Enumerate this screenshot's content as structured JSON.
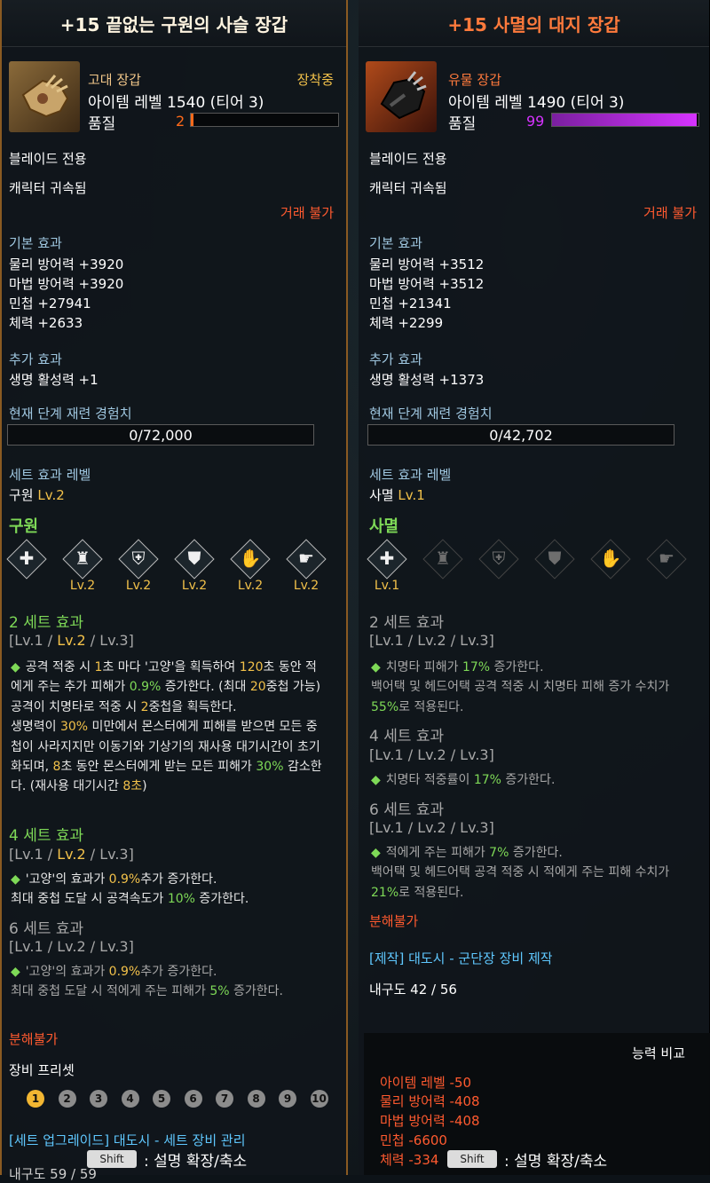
{
  "left": {
    "title": "+15 끝없는 구원의 사슬 장갑",
    "grade": "고대 장갑",
    "equipped": "장착중",
    "item_level": "아이템 레벨 1540 (티어 3)",
    "quality_label": "품질",
    "quality_value": "2",
    "quality_percent": 2,
    "class_only": "블레이드 전용",
    "bound": "캐릭터 귀속됨",
    "trade": "거래 불가",
    "basic_effect_head": "기본 효과",
    "basic_effects": [
      "물리 방어력 +3920",
      "마법 방어력 +3920",
      "민첩 +27941",
      "체력 +2633"
    ],
    "extra_effect_head": "추가 효과",
    "extra_effects": [
      "생명 활성력 +1"
    ],
    "exp_head": "현재 단계 재련 경험치",
    "exp_value": "0/72,000",
    "set_level_head": "세트 효과 레벨",
    "set_level_name": "구원",
    "set_level_lv": "Lv.2",
    "set_name": "구원",
    "set_icons": [
      {
        "name": "sword-icon",
        "glyph": "✚",
        "lv": ""
      },
      {
        "name": "helmet-icon",
        "glyph": "♜",
        "lv": "Lv.2"
      },
      {
        "name": "shoulder-armor-icon",
        "glyph": "⛨",
        "lv": "Lv.2"
      },
      {
        "name": "chest-armor-icon",
        "glyph": "⛊",
        "lv": "Lv.2"
      },
      {
        "name": "glove-icon",
        "glyph": "✋",
        "lv": "Lv.2"
      },
      {
        "name": "boots-icon",
        "glyph": "☛",
        "lv": "Lv.2"
      }
    ],
    "set2_head": "2 세트 효과",
    "set2_lv": {
      "a": "[Lv.1 / ",
      "b": "Lv.2",
      "c": " / Lv.3]"
    },
    "set2_text": {
      "p1": "공격 적중 시 ",
      "n1": "1",
      "p2": "초 마다 '고양'을 획득하여 ",
      "n2": "120",
      "p3": "초 동안 적에게 주는 추가 피해가 ",
      "n3": "0.9%",
      "p4": " 증가한다. (최대 ",
      "n4": "20",
      "p5": "중첩 가능)",
      "p6": "공격이 치명타로 적중 시 ",
      "n5": "2",
      "p7": "중첩을 획득한다.",
      "p8": "생명력이 ",
      "n6": "30%",
      "p9": " 미만에서 몬스터에게 피해를 받으면 모든 중첩이 사라지지만 이동기와 기상기의 재사용 대기시간이 초기화되며, ",
      "n7": "8",
      "p10": "초 동안 몬스터에게 받는 모든 피해가 ",
      "n8": "30%",
      "p11": " 감소한다. (재사용 대기시간 ",
      "n9": "8초",
      "p12": ")"
    },
    "set4_head": "4 세트 효과",
    "set4_lv": {
      "a": "[Lv.1 / ",
      "b": "Lv.2",
      "c": " / Lv.3]"
    },
    "set4_text": {
      "p1": "'고양'의 효과가 ",
      "n1": "0.9%",
      "p2": "추가 증가한다.",
      "p3": "최대 중첩 도달 시 공격속도가 ",
      "n2": "10%",
      "p4": " 증가한다."
    },
    "set6_head": "6 세트 효과",
    "set6_lv": "[Lv.1 / Lv.2 / Lv.3]",
    "set6_text": {
      "p1": "'고양'의 효과가 ",
      "n1": "0.9%",
      "p2": "추가 증가한다.",
      "p3": "최대 중첩 도달 시 적에게 주는 피해가 ",
      "n2": "5%",
      "p4": " 증가한다."
    },
    "disassemble": "분해불가",
    "preset_head": "장비 프리셋",
    "presets": [
      "1",
      "2",
      "3",
      "4",
      "5",
      "6",
      "7",
      "8",
      "9",
      "10"
    ],
    "upgrade_link": "[세트 업그레이드] 대도시 - 세트 장비 관리",
    "durability": "내구도 59 / 59",
    "shift_key": "Shift",
    "shift_text": ": 설명 확장/축소"
  },
  "right": {
    "title": "+15 사멸의 대지 장갑",
    "grade": "유물 장갑",
    "item_level": "아이템 레벨 1490 (티어 3)",
    "quality_label": "품질",
    "quality_value": "99",
    "quality_percent": 99,
    "class_only": "블레이드 전용",
    "bound": "캐릭터 귀속됨",
    "trade": "거래 불가",
    "basic_effect_head": "기본 효과",
    "basic_effects": [
      "물리 방어력 +3512",
      "마법 방어력 +3512",
      "민첩 +21341",
      "체력 +2299"
    ],
    "extra_effect_head": "추가 효과",
    "extra_effects": [
      "생명 활성력 +1373"
    ],
    "exp_head": "현재 단계 재련 경험치",
    "exp_value": "0/42,702",
    "set_level_head": "세트 효과 레벨",
    "set_level_name": "사멸",
    "set_level_lv": "Lv.1",
    "set_name": "사멸",
    "set_icons": [
      {
        "name": "glove-set-icon",
        "glyph": "✚",
        "lv": "Lv.1"
      },
      {
        "name": "helmet-icon",
        "glyph": "♜",
        "lv": ""
      },
      {
        "name": "shoulder-armor-icon",
        "glyph": "⛨",
        "lv": ""
      },
      {
        "name": "chest-armor-icon",
        "glyph": "⛊",
        "lv": ""
      },
      {
        "name": "glove-icon",
        "glyph": "✋",
        "lv": ""
      },
      {
        "name": "boots-icon",
        "glyph": "☛",
        "lv": ""
      }
    ],
    "set2_head": "2 세트 효과",
    "set2_lv": "[Lv.1 / Lv.2 / Lv.3]",
    "set2_text": {
      "p1": "치명타 피해가 ",
      "n1": "17%",
      "p2": " 증가한다.",
      "p3": "백어택 및 헤드어택 공격 적중 시 치명타 피해 증가 수치가 ",
      "n2": "55%",
      "p4": "로 적용된다."
    },
    "set4_head": "4 세트 효과",
    "set4_lv": "[Lv.1 / Lv.2 / Lv.3]",
    "set4_text": {
      "p1": "치명타 적중률이 ",
      "n1": "17%",
      "p2": " 증가한다."
    },
    "set6_head": "6 세트 효과",
    "set6_lv": "[Lv.1 / Lv.2 / Lv.3]",
    "set6_text": {
      "p1": "적에게 주는 피해가 ",
      "n1": "7%",
      "p2": " 증가한다.",
      "p3": "백어택 및 헤드어택 공격 적중 시 적에게 주는 피해 수치가 ",
      "n2": "21%",
      "p4": "로 적용된다."
    },
    "disassemble": "분해불가",
    "craft_link": "[제작] 대도시 - 군단장 장비 제작",
    "durability": "내구도 42 / 56",
    "compare_head": "능력 비교",
    "compare_lines": [
      "아이템 레벨 -50",
      "물리 방어력 -408",
      "마법 방어력 -408",
      "민첩 -6600",
      "체력 -334"
    ],
    "shift_key": "Shift",
    "shift_text": ": 설명 확장/축소"
  },
  "colors": {
    "quality_low": "#ff6a1a",
    "quality_high": "#d633ff",
    "set_green": "#7ed957",
    "set_yellow": "#f2c14a",
    "negative_red": "#ff5a2f"
  }
}
